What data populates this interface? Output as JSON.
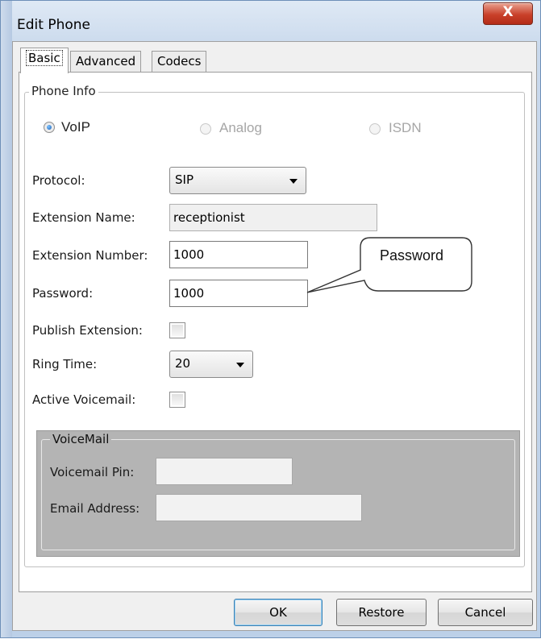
{
  "window": {
    "title": "Edit Phone",
    "close_glyph": "X",
    "close_icon": "close-icon"
  },
  "tabs": [
    {
      "label": "Basic",
      "active": true
    },
    {
      "label": "Advanced",
      "active": false
    },
    {
      "label": "Codecs",
      "active": false
    }
  ],
  "phone_info": {
    "legend": "Phone Info",
    "types": [
      {
        "label": "VoIP",
        "selected": true,
        "enabled": true
      },
      {
        "label": "Analog",
        "selected": false,
        "enabled": false
      },
      {
        "label": "ISDN",
        "selected": false,
        "enabled": false
      }
    ],
    "protocol": {
      "label": "Protocol:",
      "value": "SIP"
    },
    "extension_name": {
      "label": "Extension Name:",
      "value": "receptionist"
    },
    "extension_number": {
      "label": "Extension Number:",
      "value": "1000"
    },
    "password": {
      "label": "Password:",
      "value": "1000"
    },
    "publish_extension": {
      "label": "Publish Extension:",
      "checked": false
    },
    "ring_time": {
      "label": "Ring Time:",
      "value": "20"
    },
    "active_voicemail": {
      "label": "Active Voicemail:",
      "checked": false
    }
  },
  "voicemail": {
    "legend": "VoiceMail",
    "pin": {
      "label": "Voicemail Pin:",
      "value": ""
    },
    "email": {
      "label": "Email Address:",
      "value": ""
    }
  },
  "callout": {
    "text": "Password"
  },
  "buttons": {
    "ok": "OK",
    "restore": "Restore",
    "cancel": "Cancel"
  },
  "colors": {
    "close_red": "#c9402a",
    "frame_blue": "#bcd0e8",
    "voicemail_gray": "#b4b4b4"
  }
}
